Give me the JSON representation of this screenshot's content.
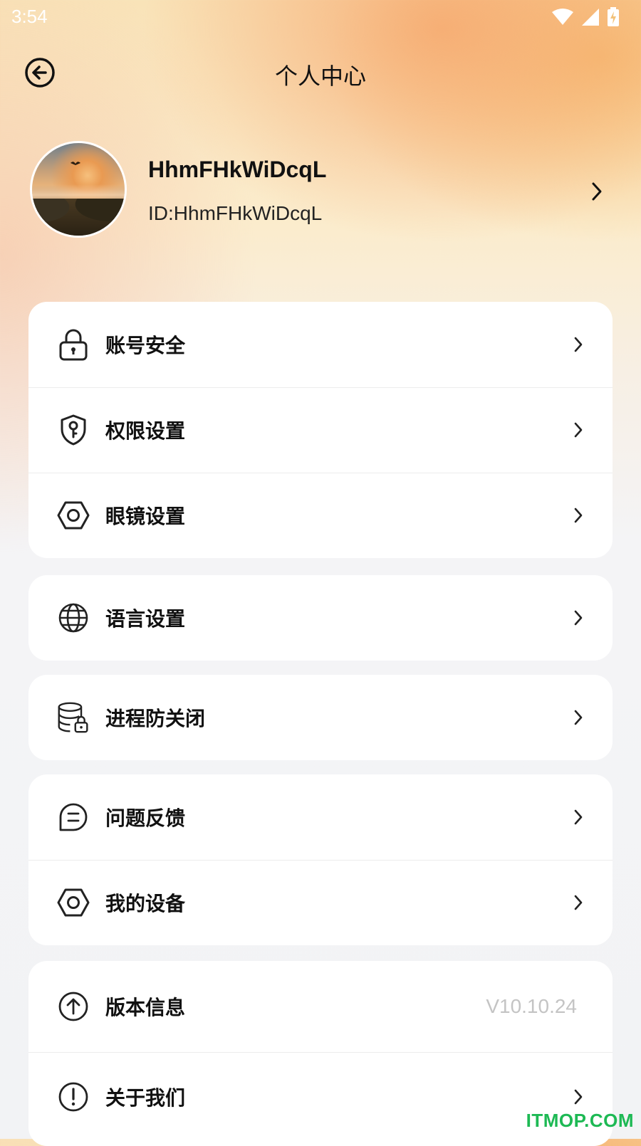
{
  "status_bar": {
    "time": "3:54",
    "icons": [
      "wifi-icon",
      "signal-icon",
      "battery-charging-icon"
    ]
  },
  "header": {
    "title": "个人中心",
    "back_icon": "back-arrow-circle-icon"
  },
  "profile": {
    "name": "HhmFHkWiDcqL",
    "id_text": "ID:HhmFHkWiDcqL"
  },
  "groups": [
    {
      "items": [
        {
          "label": "账号安全",
          "icon": "lock-icon"
        },
        {
          "label": "权限设置",
          "icon": "shield-key-icon"
        },
        {
          "label": "眼镜设置",
          "icon": "hexagon-nut-icon"
        }
      ]
    },
    {
      "items": [
        {
          "label": "语言设置",
          "icon": "globe-icon"
        }
      ]
    },
    {
      "items": [
        {
          "label": "进程防关闭",
          "icon": "database-lock-icon"
        }
      ]
    },
    {
      "items": [
        {
          "label": "问题反馈",
          "icon": "feedback-bubble-icon"
        },
        {
          "label": "我的设备",
          "icon": "hexagon-nut-icon"
        }
      ]
    },
    {
      "items": [
        {
          "label": "版本信息",
          "icon": "upload-circle-icon",
          "value": "V10.10.24"
        },
        {
          "label": "关于我们",
          "icon": "info-exclamation-icon"
        }
      ]
    }
  ],
  "watermark": "ITMOP.COM",
  "colors": {
    "text_primary": "#111111",
    "value_gray": "#c4c4c4",
    "card_bg": "#ffffff",
    "watermark_green": "#1db954"
  }
}
